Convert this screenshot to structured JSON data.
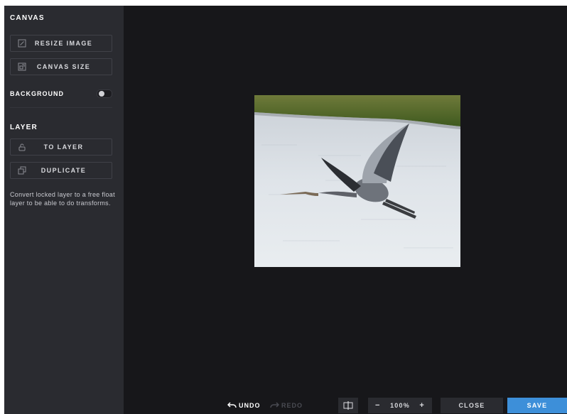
{
  "sidebar": {
    "canvas_title": "CANVAS",
    "resize_label": "RESIZE IMAGE",
    "canvas_size_label": "CANVAS SIZE",
    "background_label": "BACKGROUND",
    "layer_title": "LAYER",
    "to_layer_label": "TO LAYER",
    "duplicate_label": "DUPLICATE",
    "hint": "Convert locked layer to a free float layer to be able to do transforms."
  },
  "toolbar": {
    "undo_label": "UNDO",
    "redo_label": "REDO",
    "zoom_minus": "−",
    "zoom_value": "100%",
    "zoom_plus": "+",
    "close_label": "CLOSE",
    "save_label": "SAVE"
  },
  "icons": {
    "resize": "resize-icon",
    "canvas_size": "canvas-size-icon",
    "to_layer": "unlock-icon",
    "duplicate": "duplicate-icon",
    "undo": "undo-icon",
    "redo": "redo-icon",
    "compare": "compare-icon"
  },
  "colors": {
    "sidebar_bg": "#2a2b30",
    "workspace_bg": "#17171a",
    "save_accent": "#3d8fd9"
  }
}
